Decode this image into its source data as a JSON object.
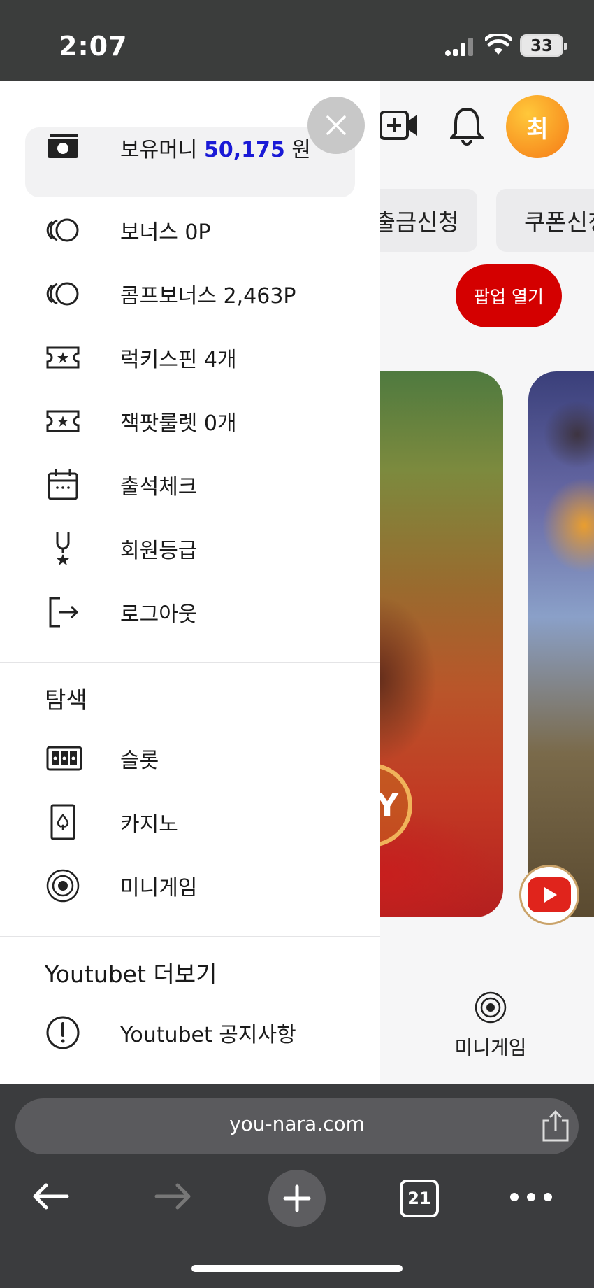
{
  "status_bar": {
    "time": "2:07",
    "battery": "33"
  },
  "header": {
    "avatar_initial": "최"
  },
  "site": {
    "chip_withdraw": "출금신청",
    "chip_coupon": "쿠폰신청",
    "popup_button": "팝업 열기",
    "banner_play": "AY",
    "mini_game_label": "미니게임"
  },
  "drawer": {
    "money": {
      "label": "보유머니",
      "amount": "50,175",
      "unit": "원"
    },
    "items": [
      {
        "label": "보너스 0P",
        "icon": "coins-icon"
      },
      {
        "label": "콤프보너스 2,463P",
        "icon": "coins-icon"
      },
      {
        "label": "럭키스핀 4개",
        "icon": "ticket-icon"
      },
      {
        "label": "잭팟룰렛 0개",
        "icon": "ticket-icon"
      },
      {
        "label": "출석체크",
        "icon": "calendar-icon"
      },
      {
        "label": "회원등급",
        "icon": "medal-icon"
      },
      {
        "label": "로그아웃",
        "icon": "logout-icon"
      }
    ],
    "explore": {
      "title": "탐색",
      "items": [
        {
          "label": "슬롯",
          "icon": "slot-machine-icon"
        },
        {
          "label": "카지노",
          "icon": "playing-card-icon"
        },
        {
          "label": "미니게임",
          "icon": "chip-icon"
        }
      ]
    },
    "more": {
      "title": "Youtubet 더보기",
      "items": [
        {
          "label": "Youtubet 공지사항",
          "icon": "alert-circle-icon"
        }
      ]
    }
  },
  "browser": {
    "url": "you-nara.com",
    "tab_count": "21"
  }
}
